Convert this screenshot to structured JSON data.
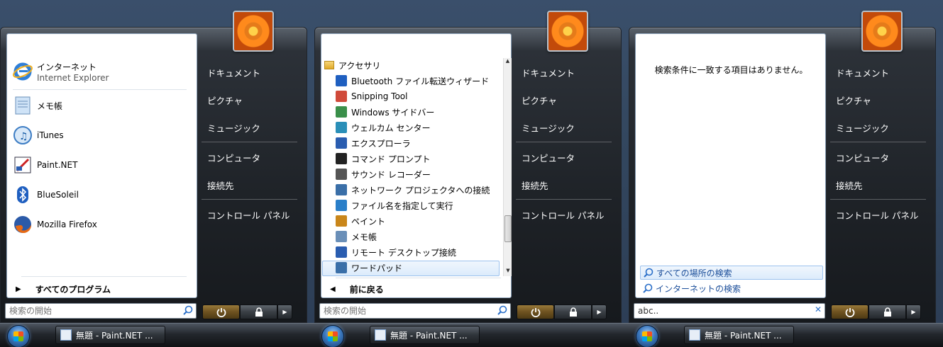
{
  "user_picture": "orange-flower-avatar",
  "right_menu": [
    "ドキュメント",
    "ピクチャ",
    "ミュージック",
    "コンピュータ",
    "接続先",
    "コントロール パネル"
  ],
  "panel1": {
    "programs": [
      {
        "title": "インターネット",
        "subtitle": "Internet Explorer",
        "icon": "internet-explorer-icon"
      },
      {
        "title": "メモ帳",
        "icon": "notepad-icon"
      },
      {
        "title": "iTunes",
        "icon": "itunes-icon"
      },
      {
        "title": "Paint.NET",
        "icon": "paint-net-icon"
      },
      {
        "title": "BlueSoleil",
        "icon": "bluetooth-icon"
      },
      {
        "title": "Mozilla Firefox",
        "icon": "firefox-icon"
      }
    ],
    "all_programs": "すべてのプログラム",
    "search_placeholder": "検索の開始"
  },
  "panel2": {
    "folder": "アクセサリ",
    "items": [
      {
        "label": "Bluetooth ファイル転送ウィザード",
        "icon": "bluetooth-icon"
      },
      {
        "label": "Snipping Tool",
        "icon": "scissors-icon"
      },
      {
        "label": "Windows サイドバー",
        "icon": "sidebar-icon"
      },
      {
        "label": "ウェルカム センター",
        "icon": "welcome-center-icon"
      },
      {
        "label": "エクスプローラ",
        "icon": "explorer-icon"
      },
      {
        "label": "コマンド プロンプト",
        "icon": "command-prompt-icon"
      },
      {
        "label": "サウンド レコーダー",
        "icon": "microphone-icon"
      },
      {
        "label": "ネットワーク プロジェクタへの接続",
        "icon": "projector-icon"
      },
      {
        "label": "ファイル名を指定して実行",
        "icon": "run-icon"
      },
      {
        "label": "ペイント",
        "icon": "paint-icon"
      },
      {
        "label": "メモ帳",
        "icon": "notepad-icon"
      },
      {
        "label": "リモート デスクトップ接続",
        "icon": "remote-desktop-icon"
      },
      {
        "label": "ワードパッド",
        "icon": "wordpad-icon"
      }
    ],
    "back": "前に戻る",
    "search_placeholder": "検索の開始"
  },
  "panel3": {
    "no_results": "検索条件に一致する項目はありません。",
    "search_everywhere": "すべての場所の検索",
    "search_internet": "インターネットの検索",
    "search_value": "abc.."
  },
  "taskbar": {
    "task_label": "無題 - Paint.NET ..."
  }
}
